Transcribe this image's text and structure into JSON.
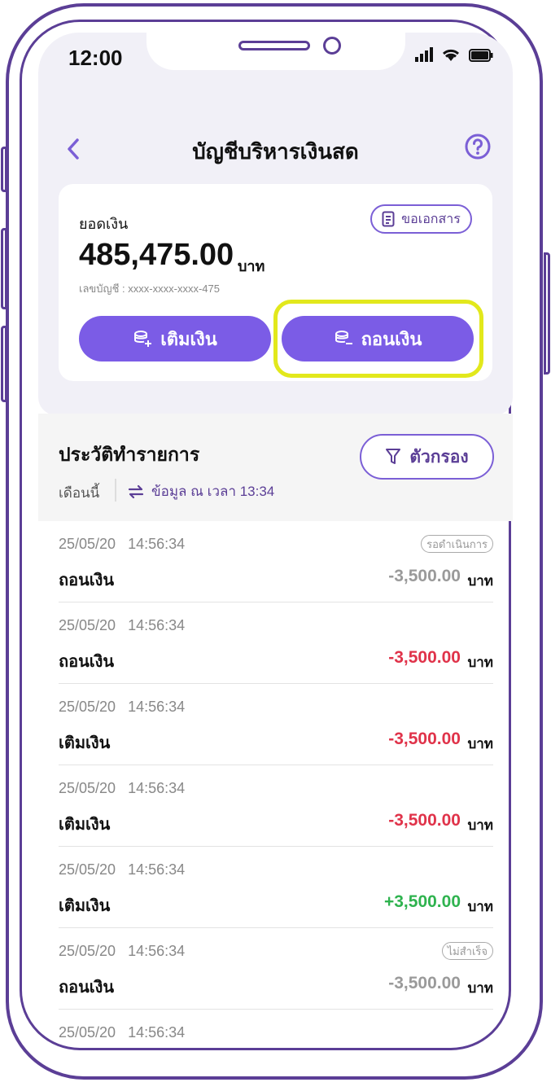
{
  "status_bar": {
    "time": "12:00"
  },
  "header": {
    "title": "บัญชีบริหารเงินสด"
  },
  "balance": {
    "label": "ยอดเงิน",
    "amount": "485,475.00",
    "unit": "บาท",
    "account_number": "เลขบัญชี : xxxx-xxxx-xxxx-475",
    "doc_button": "ขอเอกสาร"
  },
  "actions": {
    "topup": "เติมเงิน",
    "withdraw": "ถอนเงิน"
  },
  "history": {
    "title": "ประวัติทำรายการ",
    "month": "เดือนนี้",
    "refresh": "ข้อมูล ณ เวลา 13:34",
    "filter": "ตัวกรอง"
  },
  "transactions": [
    {
      "date": "25/05/20",
      "time": "14:56:34",
      "label": "ถอนเงิน",
      "amount": "-3,500.00",
      "unit": "บาท",
      "badge": "รอดำเนินการ",
      "tone": "grey"
    },
    {
      "date": "25/05/20",
      "time": "14:56:34",
      "label": "ถอนเงิน",
      "amount": "-3,500.00",
      "unit": "บาท",
      "badge": "",
      "tone": "red"
    },
    {
      "date": "25/05/20",
      "time": "14:56:34",
      "label": "เติมเงิน",
      "amount": "-3,500.00",
      "unit": "บาท",
      "badge": "",
      "tone": "red"
    },
    {
      "date": "25/05/20",
      "time": "14:56:34",
      "label": "เติมเงิน",
      "amount": "-3,500.00",
      "unit": "บาท",
      "badge": "",
      "tone": "red"
    },
    {
      "date": "25/05/20",
      "time": "14:56:34",
      "label": "เติมเงิน",
      "amount": "+3,500.00",
      "unit": "บาท",
      "badge": "",
      "tone": "green"
    },
    {
      "date": "25/05/20",
      "time": "14:56:34",
      "label": "ถอนเงิน",
      "amount": "-3,500.00",
      "unit": "บาท",
      "badge": "ไม่สำเร็จ",
      "tone": "grey"
    },
    {
      "date": "25/05/20",
      "time": "14:56:34",
      "label": "",
      "amount": "",
      "unit": "",
      "badge": "",
      "tone": "grey"
    }
  ],
  "colors": {
    "accent": "#7b5ce6",
    "frame": "#5b3e96",
    "highlight": "#e2e81c",
    "negative": "#e0334a",
    "positive": "#2fb34f"
  },
  "icons": [
    "back-chevron-icon",
    "help-icon",
    "document-icon",
    "topup-coins-icon",
    "withdraw-coins-icon",
    "refresh-icon",
    "filter-icon",
    "signal-icon",
    "wifi-icon",
    "battery-icon"
  ]
}
